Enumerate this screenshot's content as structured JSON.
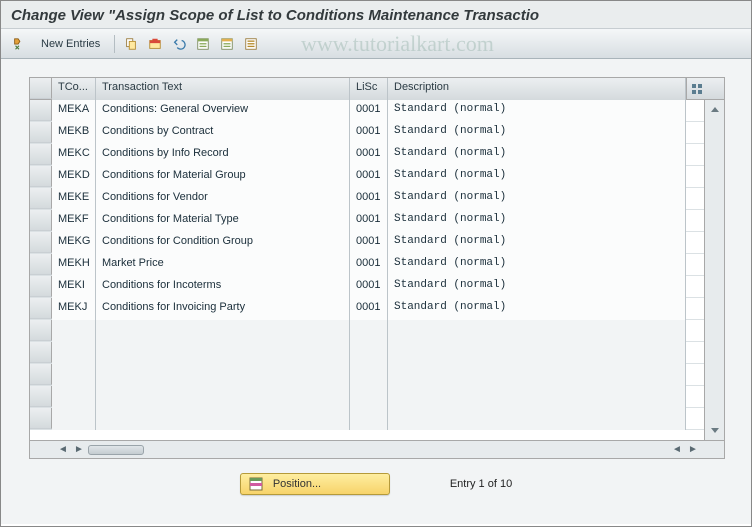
{
  "title": "Change View \"Assign Scope of List to Conditions Maintenance Transactio",
  "watermark": "www.tutorialkart.com",
  "toolbar": {
    "new_entries_label": "New Entries"
  },
  "columns": {
    "tcode": "TCo...",
    "text": "Transaction Text",
    "lisc": "LiSc",
    "desc": "Description"
  },
  "rows": [
    {
      "tcode": "MEKA",
      "text": "Conditions: General Overview",
      "lisc": "0001",
      "desc": "Standard (normal)"
    },
    {
      "tcode": "MEKB",
      "text": "Conditions by Contract",
      "lisc": "0001",
      "desc": "Standard (normal)"
    },
    {
      "tcode": "MEKC",
      "text": "Conditions by Info Record",
      "lisc": "0001",
      "desc": "Standard (normal)"
    },
    {
      "tcode": "MEKD",
      "text": "Conditions for Material Group",
      "lisc": "0001",
      "desc": "Standard (normal)"
    },
    {
      "tcode": "MEKE",
      "text": "Conditions for Vendor",
      "lisc": "0001",
      "desc": "Standard (normal)"
    },
    {
      "tcode": "MEKF",
      "text": "Conditions for Material Type",
      "lisc": "0001",
      "desc": "Standard (normal)"
    },
    {
      "tcode": "MEKG",
      "text": "Conditions for Condition Group",
      "lisc": "0001",
      "desc": "Standard (normal)"
    },
    {
      "tcode": "MEKH",
      "text": "Market Price",
      "lisc": "0001",
      "desc": "Standard (normal)"
    },
    {
      "tcode": "MEKI",
      "text": "Conditions for Incoterms",
      "lisc": "0001",
      "desc": "Standard (normal)"
    },
    {
      "tcode": "MEKJ",
      "text": "Conditions for Invoicing Party",
      "lisc": "0001",
      "desc": "Standard (normal)"
    }
  ],
  "empty_rows": 5,
  "footer": {
    "position_label": "Position...",
    "entry_label": "Entry 1 of 10"
  }
}
